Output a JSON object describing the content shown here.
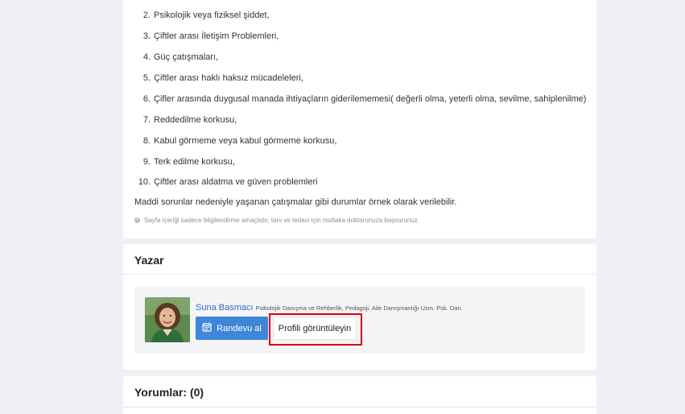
{
  "article": {
    "list_items": [
      {
        "num": "2.",
        "text": "Psikolojik veya fiziksel şiddet,"
      },
      {
        "num": "3.",
        "text": "Çiftler arası İletişim Problemleri,"
      },
      {
        "num": "4.",
        "text": "Güç çatışmaları,"
      },
      {
        "num": "5.",
        "text": "Çiftler arası haklı haksız mücadeleleri,"
      },
      {
        "num": "6.",
        "text": "Çifler arasında duygusal manada ihtiyaçların giderilememesi( değerli olma, yeterli olma, sevilme, sahiplenilme)"
      },
      {
        "num": "7.",
        "text": "Reddedilme korkusu,"
      },
      {
        "num": "8.",
        "text": "Kabul görmeme veya kabul görmeme korkusu,"
      },
      {
        "num": "9.",
        "text": "Terk edilme korkusu,"
      },
      {
        "num": "10.",
        "text": "Çiftler arası aldatma ve güven problemleri"
      }
    ],
    "closing_text": "Maddi sorunlar nedeniyle yaşanan çatışmalar gibi durumlar örnek olarak verilebilir.",
    "disclaimer": "Sayfa içeriği sadece bilgilendirme amaçlıdır, tanı ve tedavi için mutlaka doktorunuza başvurunuz."
  },
  "author_section": {
    "title": "Yazar",
    "name": "Suna Basmacı",
    "description": "Psikolojik Danışma ve Rehberlik, Pedagoji, Aile Danışmanlığı Uzm. Psk. Dan.",
    "appointment_button": "Randevu al",
    "profile_button": "Profili görüntüleyin"
  },
  "comments_section": {
    "title": "Yorumlar: (0)"
  },
  "colors": {
    "accent": "#3f86d8",
    "highlight": "#d9000d",
    "link": "#2d6cc0"
  }
}
